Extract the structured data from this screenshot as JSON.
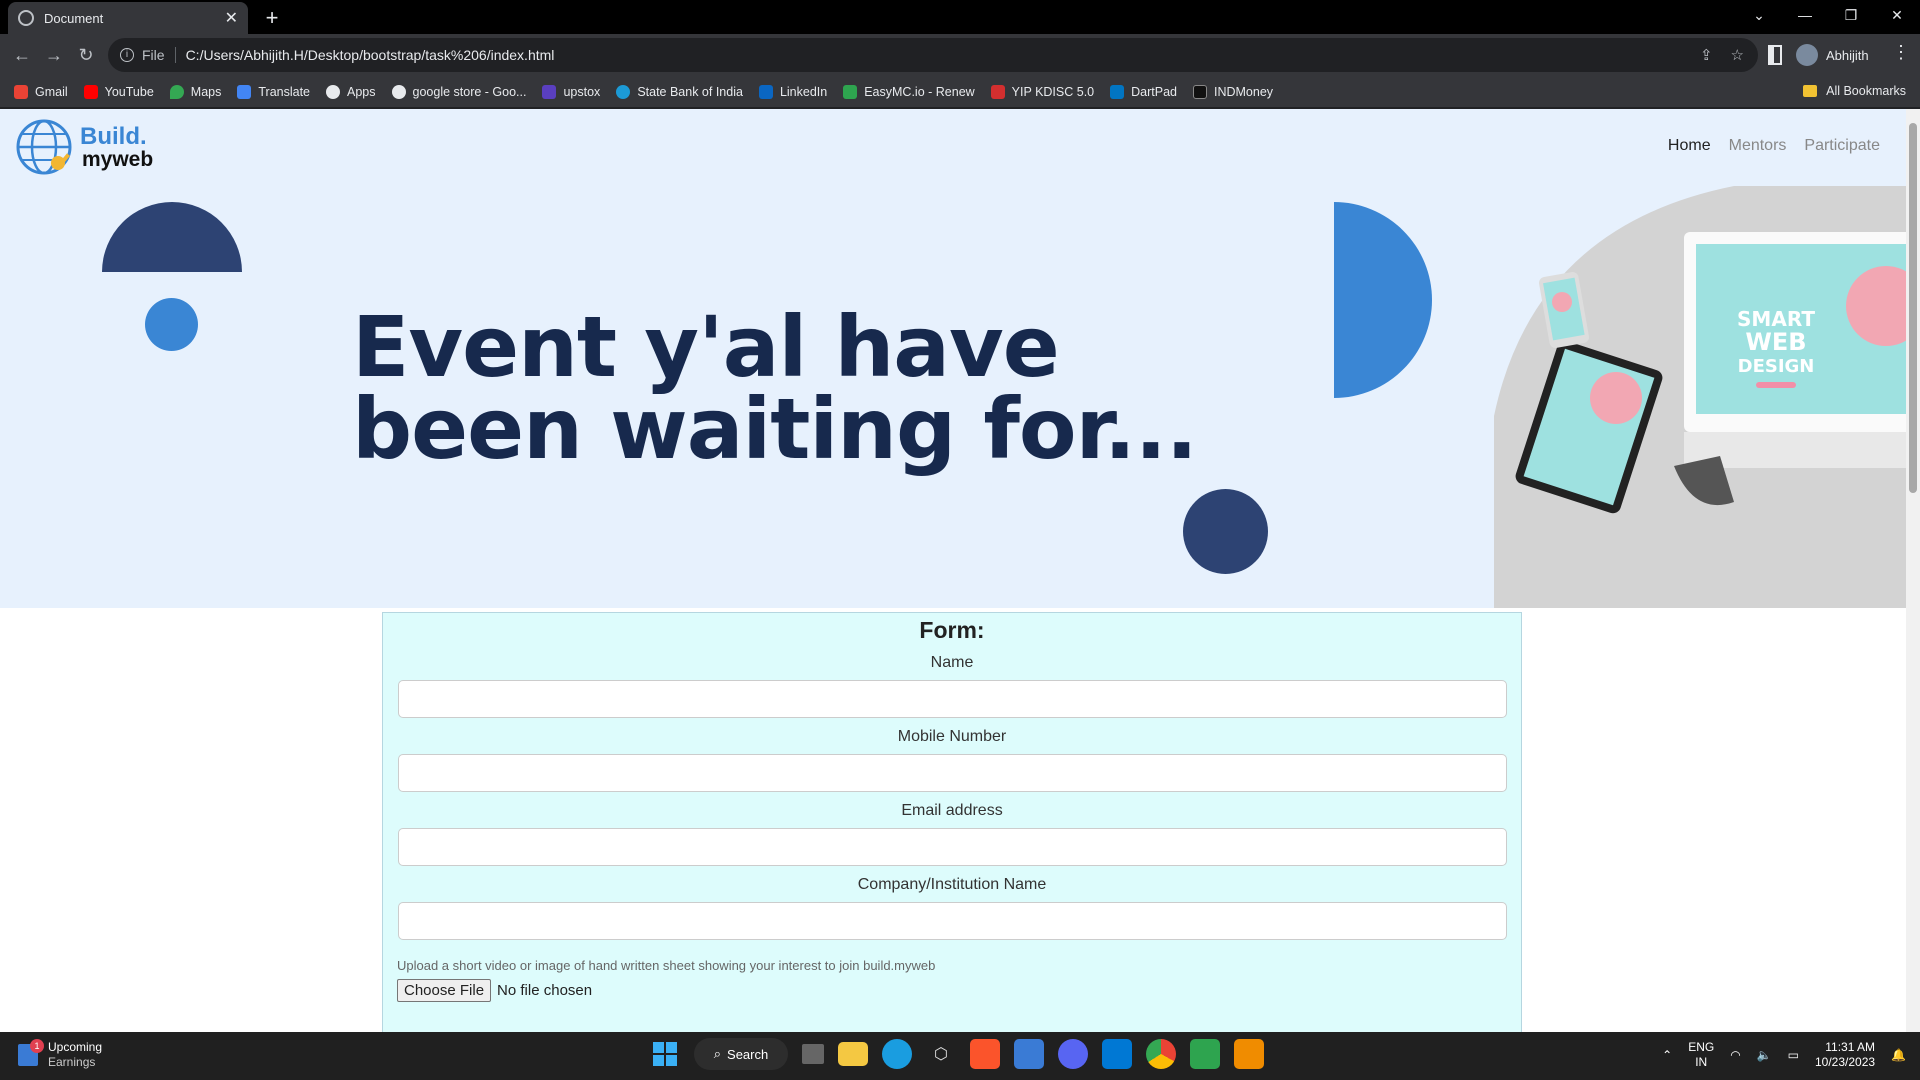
{
  "browser": {
    "tab_title": "Document",
    "new_tab": "+",
    "window_controls": [
      "⌄",
      "—",
      "❐",
      "✕"
    ],
    "file_label": "File",
    "url": "C:/Users/Abhijith.H/Desktop/bootstrap/task%206/index.html",
    "profile_name": "Abhijith",
    "bookmarks": [
      {
        "label": "Gmail",
        "color": "#ea4335"
      },
      {
        "label": "YouTube",
        "color": "#ff0000"
      },
      {
        "label": "Maps",
        "color": "#34a853"
      },
      {
        "label": "Translate",
        "color": "#4285f4"
      },
      {
        "label": "Apps",
        "color": "#e8eaed"
      },
      {
        "label": "google store - Goo...",
        "color": "#e8eaed"
      },
      {
        "label": "upstox",
        "color": "#5a3fc0"
      },
      {
        "label": "State Bank of India",
        "color": "#1c9ad6"
      },
      {
        "label": "LinkedIn",
        "color": "#0a66c2"
      },
      {
        "label": "EasyMC.io - Renew",
        "color": "#2ea44f"
      },
      {
        "label": "YIP KDISC 5.0",
        "color": "#d32f2f"
      },
      {
        "label": "DartPad",
        "color": "#0175c2"
      },
      {
        "label": "INDMoney",
        "color": "#111111"
      }
    ],
    "all_bookmarks": "All Bookmarks"
  },
  "site": {
    "brand_line1": "Build.",
    "brand_line2": "myweb",
    "nav": [
      "Home",
      "Mentors",
      "Participate"
    ],
    "hero_line1": "Event y'al have",
    "hero_line2": "been waiting for...",
    "colors": {
      "navy": "#17294d",
      "accent": "#3a86d4",
      "hero_bg": "#e7f1fd",
      "form_bg": "#ddfcfc"
    }
  },
  "form": {
    "title": "Form:",
    "fields": [
      {
        "label": "Name",
        "value": ""
      },
      {
        "label": "Mobile Number",
        "value": ""
      },
      {
        "label": "Email address",
        "value": ""
      },
      {
        "label": "Company/Institution Name",
        "value": ""
      }
    ],
    "upload_hint": "Upload a short video or image of hand written sheet showing your interest to join build.myweb",
    "choose_file": "Choose File",
    "no_file": "No file chosen"
  },
  "taskbar": {
    "widget_title": "Upcoming",
    "widget_sub": "Earnings",
    "widget_badge": "1",
    "search_label": "Search",
    "lang_line1": "ENG",
    "lang_line2": "IN",
    "time": "11:31 AM",
    "date": "10/23/2023"
  }
}
